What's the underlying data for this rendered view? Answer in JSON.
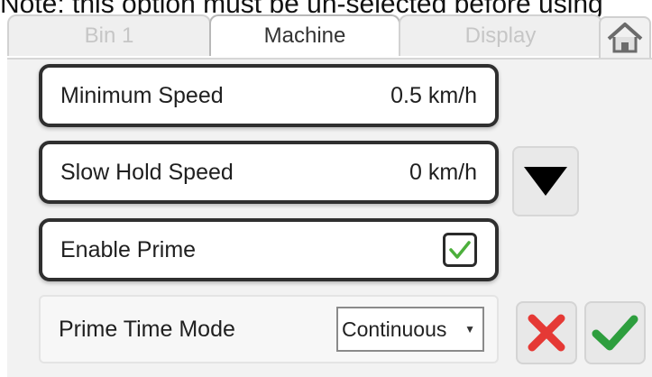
{
  "note": "Note: this option must be un-selected before using",
  "tabs": [
    "Bin 1",
    "Machine",
    "Display"
  ],
  "settings": {
    "minimum_speed": {
      "label": "Minimum Speed",
      "value": "0.5 km/h"
    },
    "slow_hold_speed": {
      "label": "Slow Hold Speed",
      "value": "0 km/h"
    },
    "enable_prime": {
      "label": "Enable Prime",
      "checked": true
    },
    "prime_time_mode": {
      "label": "Prime Time Mode",
      "selected": "Continuous"
    }
  },
  "colors": {
    "check_green": "#4caf3b",
    "cancel_red": "#e53935",
    "confirm_green": "#2e9e3e"
  },
  "icons": [
    "home-icon",
    "down-arrow-icon",
    "checkbox-check-icon",
    "dropdown-arrow-icon",
    "cancel-x-icon",
    "confirm-check-icon"
  ]
}
